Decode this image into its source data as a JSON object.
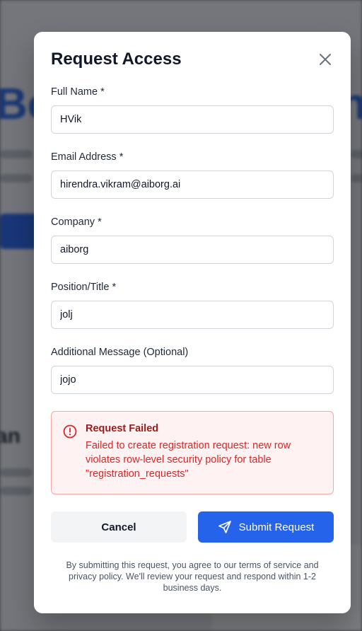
{
  "modal": {
    "title": "Request Access",
    "fields": {
      "full_name": {
        "label": "Full Name *",
        "value": "HVik"
      },
      "email": {
        "label": "Email Address *",
        "value": "hirendra.vikram@aiborg.ai"
      },
      "company": {
        "label": "Company *",
        "value": "aiborg"
      },
      "position": {
        "label": "Position/Title *",
        "value": "jolj"
      },
      "message": {
        "label": "Additional Message (Optional)",
        "value": "jojo"
      }
    },
    "error": {
      "title": "Request Failed",
      "message": "Failed to create registration request: new row violates row-level security policy for table \"registration_requests\""
    },
    "buttons": {
      "cancel": "Cancel",
      "submit": "Submit Request"
    },
    "footnote": "By submitting this request, you agree to our terms of service and privacy policy. We'll review your request and respond within 1-2 business days."
  },
  "colors": {
    "primary": "#2563eb",
    "error_text": "#dc2626",
    "error_bg": "#fef2f2",
    "error_border": "#fca5a5"
  },
  "icons": {
    "close": "close-icon",
    "error": "alert-circle-icon",
    "submit": "send-icon"
  }
}
